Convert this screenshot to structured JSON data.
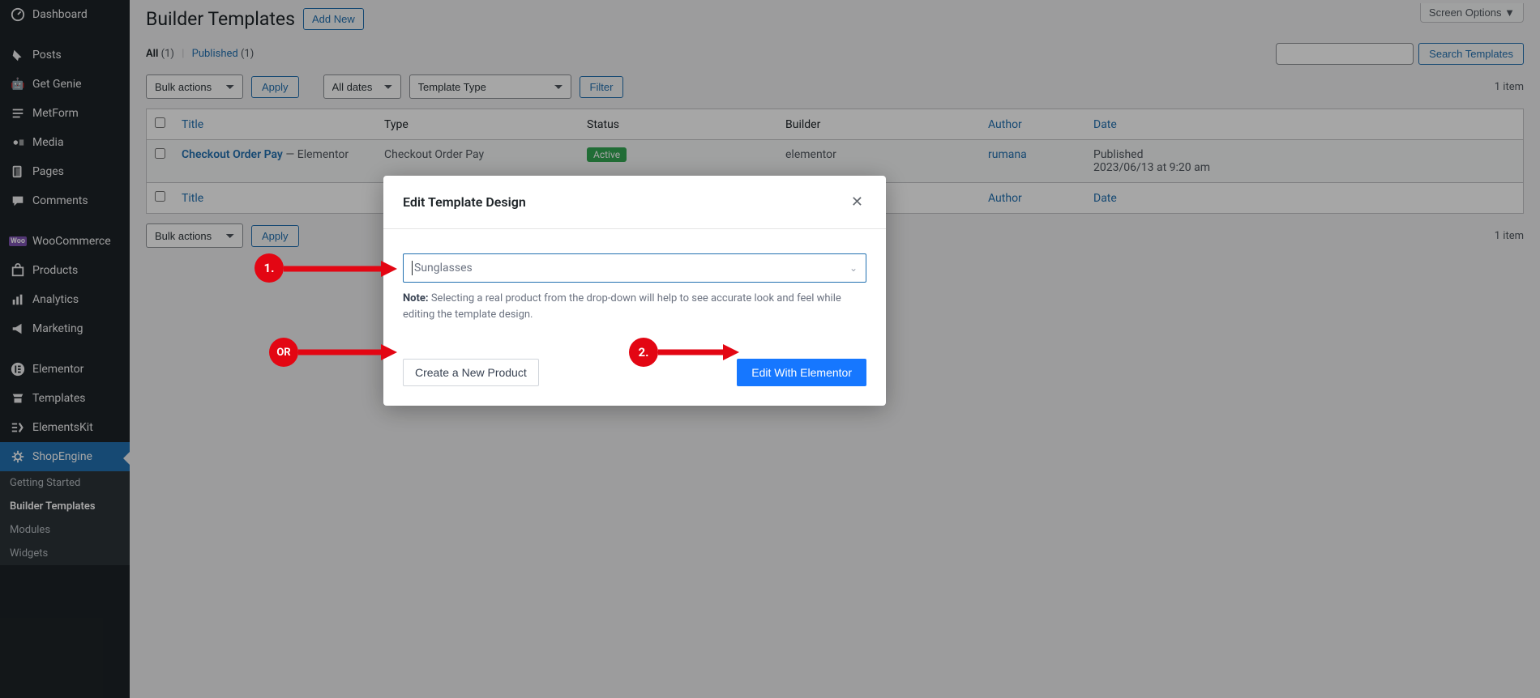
{
  "sidebar": {
    "items": [
      {
        "label": "Dashboard",
        "icon": "dashboard-icon"
      },
      {
        "label": "Posts",
        "icon": "pin-icon"
      },
      {
        "label": "Get Genie",
        "icon": "genie-icon"
      },
      {
        "label": "MetForm",
        "icon": "metform-icon"
      },
      {
        "label": "Media",
        "icon": "media-icon"
      },
      {
        "label": "Pages",
        "icon": "pages-icon"
      },
      {
        "label": "Comments",
        "icon": "comments-icon"
      },
      {
        "label": "WooCommerce",
        "icon": "woo-icon"
      },
      {
        "label": "Products",
        "icon": "products-icon"
      },
      {
        "label": "Analytics",
        "icon": "analytics-icon"
      },
      {
        "label": "Marketing",
        "icon": "marketing-icon"
      },
      {
        "label": "Elementor",
        "icon": "elementor-icon"
      },
      {
        "label": "Templates",
        "icon": "templates-icon"
      },
      {
        "label": "ElementsKit",
        "icon": "elementskit-icon"
      },
      {
        "label": "ShopEngine",
        "icon": "shopengine-icon"
      }
    ],
    "submenu": [
      {
        "label": "Getting Started"
      },
      {
        "label": "Builder Templates"
      },
      {
        "label": "Modules"
      },
      {
        "label": "Widgets"
      }
    ]
  },
  "header": {
    "page_title": "Builder Templates",
    "add_new": "Add New",
    "screen_options": "Screen Options ▼"
  },
  "filters": {
    "all_label": "All",
    "all_count": "(1)",
    "published_label": "Published",
    "published_count": "(1)",
    "search_label": "Search Templates"
  },
  "controls": {
    "bulk_actions": "Bulk actions",
    "apply": "Apply",
    "all_dates": "All dates",
    "template_type": "Template Type",
    "filter": "Filter",
    "item_count": "1 item"
  },
  "table": {
    "headers": {
      "title": "Title",
      "type": "Type",
      "status": "Status",
      "builder": "Builder",
      "author": "Author",
      "date": "Date"
    },
    "rows": [
      {
        "title": "Checkout Order Pay",
        "title_suffix": " — Elementor",
        "type": "Checkout Order Pay",
        "status": "Active",
        "builder": "elementor",
        "author": "rumana",
        "date_line1": "Published",
        "date_line2": "2023/06/13 at 9:20 am"
      }
    ]
  },
  "modal": {
    "title": "Edit Template Design",
    "product_placeholder": "Sunglasses",
    "note_label": "Note: ",
    "note_text": "Selecting a real product from the drop-down will help to see accurate look and feel while editing the template design.",
    "create_label": "Create a New Product",
    "edit_label": "Edit With Elementor"
  },
  "callouts": {
    "one": "1.",
    "two": "2.",
    "or": "OR"
  }
}
